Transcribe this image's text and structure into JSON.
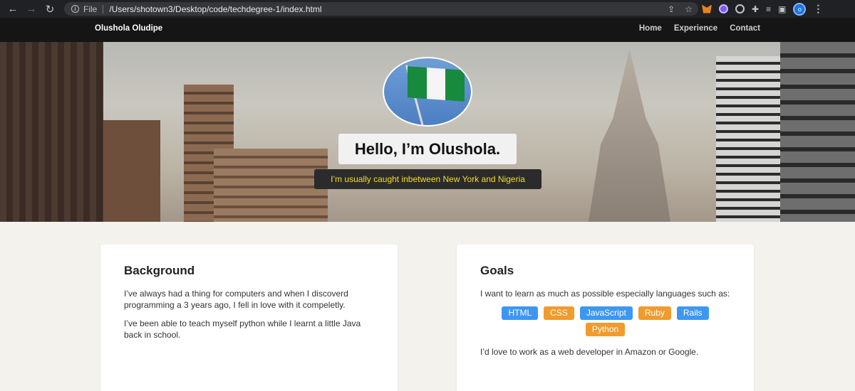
{
  "browser": {
    "file_label": "File",
    "url": "/Users/shotown3/Desktop/code/techdegree-1/index.html",
    "profile_initial": "o"
  },
  "site": {
    "brand": "Olushola Oludipe",
    "nav": [
      "Home",
      "Experience",
      "Contact"
    ]
  },
  "hero": {
    "title": "Hello, I’m Olushola.",
    "subtitle": "I’m usually caught inbetween New York and Nigeria"
  },
  "background": {
    "heading": "Background",
    "paragraphs": [
      "I’ve always had a thing for computers and when I discoverd programming a 3 years ago, I fell in love with it compeletly.",
      "I’ve been able to teach myself python while I learnt a little Java back in school."
    ]
  },
  "goals": {
    "heading": "Goals",
    "intro": "I want to learn as much as possible especially languages such as:",
    "tags": [
      {
        "label": "HTML",
        "color": "blue"
      },
      {
        "label": "CSS",
        "color": "orange"
      },
      {
        "label": "JavaScript",
        "color": "blue"
      },
      {
        "label": "Ruby",
        "color": "orange"
      },
      {
        "label": "Rails",
        "color": "blue"
      },
      {
        "label": "Python",
        "color": "orange"
      }
    ],
    "outro": "I’d love to work as a web developer in Amazon or Google."
  },
  "colors": {
    "tag_blue": "#3d97f0",
    "tag_orange": "#f09b2e",
    "subtitle_text": "#f5dc2a",
    "navbar_bg": "#151515"
  },
  "icons": [
    "back-arrow-icon",
    "forward-arrow-icon",
    "reload-icon",
    "info-icon",
    "share-icon",
    "bookmark-star-icon",
    "metamask-extension-icon",
    "extension-icon",
    "puzzle-icon",
    "media-icon",
    "sidebar-icon",
    "kebab-menu-icon"
  ]
}
